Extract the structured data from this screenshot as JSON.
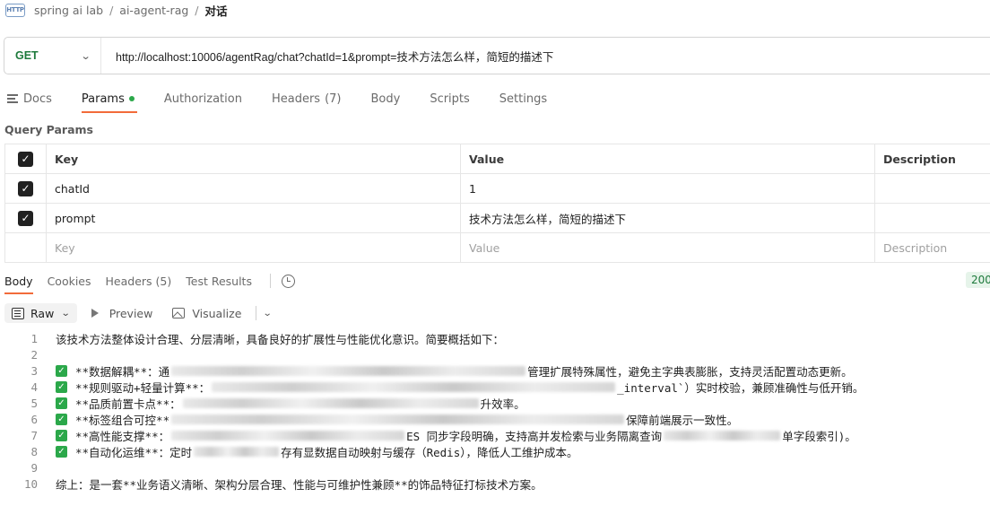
{
  "breadcrumb": {
    "icon_text": "HTTP",
    "items": [
      "spring ai lab",
      "ai-agent-rag"
    ],
    "separator": "/",
    "current": "对话"
  },
  "request": {
    "method": "GET",
    "url": "http://localhost:10006/agentRag/chat?chatId=1&prompt=技术方法怎么样，简短的描述下"
  },
  "request_tabs": [
    {
      "label": "Docs"
    },
    {
      "label": "Params",
      "active": true,
      "dot_color": "#2ba84a"
    },
    {
      "label": "Authorization"
    },
    {
      "label": "Headers",
      "count": "(7)"
    },
    {
      "label": "Body"
    },
    {
      "label": "Scripts"
    },
    {
      "label": "Settings"
    }
  ],
  "query_params": {
    "title": "Query Params",
    "headers": {
      "key": "Key",
      "value": "Value",
      "description": "Description"
    },
    "rows": [
      {
        "checked": true,
        "key": "chatId",
        "value": "1",
        "description": ""
      },
      {
        "checked": true,
        "key": "prompt",
        "value": "技术方法怎么样，简短的描述下",
        "description": ""
      }
    ],
    "empty_row": {
      "key": "Key",
      "value": "Value",
      "description": "Description"
    }
  },
  "response_tabs": [
    {
      "label": "Body",
      "active": true
    },
    {
      "label": "Cookies"
    },
    {
      "label": "Headers",
      "count": "(5)"
    },
    {
      "label": "Test Results"
    }
  ],
  "status": {
    "text": "200",
    "color": "#1e7a3c"
  },
  "body_toolbar": {
    "format": "Raw",
    "preview": "Preview",
    "visualize": "Visualize"
  },
  "response_lines": [
    {
      "num": "1",
      "text": "该技术方法整体设计合理、分层清晰，具备良好的扩展性与性能优化意识。简要概括如下："
    },
    {
      "num": "2",
      "text": ""
    },
    {
      "num": "3",
      "check": true,
      "before": "**数据解耦**：通",
      "after": "管理扩展特殊属性，避免主字典表膨胀，支持灵活配置动态更新。"
    },
    {
      "num": "4",
      "check": true,
      "before": "**规则驱动+轻量计算**：",
      "after": "_interval`）实时校验，兼顾准确性与低开销。"
    },
    {
      "num": "5",
      "check": true,
      "before": "**品质前置卡点**：",
      "after": "升效率。"
    },
    {
      "num": "6",
      "check": true,
      "before": "**标签组合可控**",
      "after": "保障前端展示一致性。"
    },
    {
      "num": "7",
      "check": true,
      "before": "**高性能支撑**：",
      "after": "ES 同步字段明确，支持高并发检索与业务隔离查询",
      "tail": "单字段索引)。"
    },
    {
      "num": "8",
      "check": true,
      "before": "**自动化运维**：定时",
      "after": "存有显数据自动映射与缓存（Redis），降低人工维护成本。"
    },
    {
      "num": "9",
      "text": ""
    },
    {
      "num": "10",
      "text": "综上：是一套**业务语义清晰、架构分层合理、性能与可维护性兼顾**的饰品特征打标技术方案。"
    }
  ]
}
